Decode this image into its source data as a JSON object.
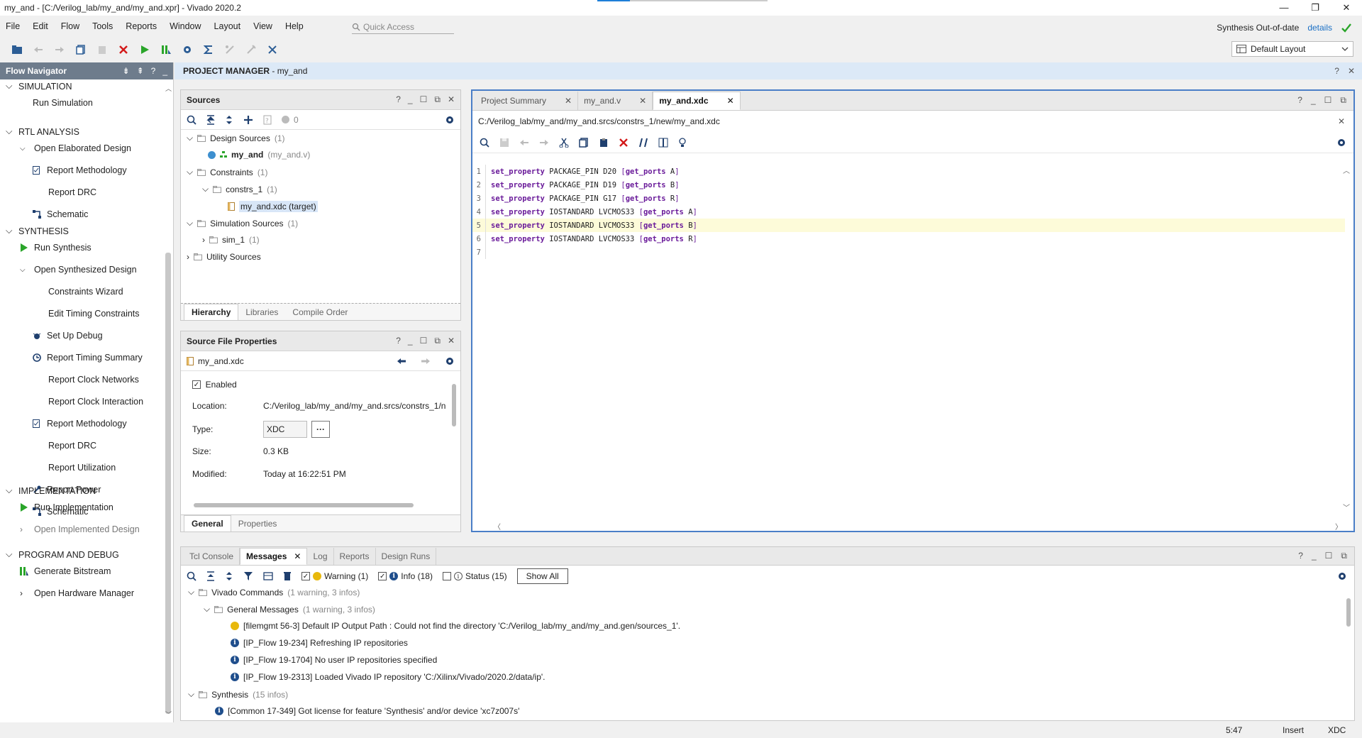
{
  "window": {
    "title": "my_and - [C:/Verilog_lab/my_and/my_and.xpr] - Vivado 2020.2",
    "controls": [
      "—",
      "❐",
      "✕"
    ]
  },
  "menu": [
    "File",
    "Edit",
    "Flow",
    "Tools",
    "Reports",
    "Window",
    "Layout",
    "View",
    "Help"
  ],
  "quick_access": {
    "placeholder": "Quick Access"
  },
  "synthesis_status": {
    "text": "Synthesis Out-of-date",
    "link": "details"
  },
  "layout_selector": {
    "value": "Default Layout"
  },
  "flow_navigator": {
    "title": "Flow Navigator",
    "sections": [
      {
        "label": "SIMULATION",
        "items": [
          {
            "label": "Run Simulation",
            "icon": ""
          }
        ]
      },
      {
        "label": "RTL ANALYSIS",
        "items": [
          {
            "label": "Open Elaborated Design",
            "icon": "chevron"
          },
          {
            "label": "Report Methodology",
            "icon": "report"
          },
          {
            "label": "Report DRC",
            "icon": ""
          },
          {
            "label": "Schematic",
            "icon": "schematic"
          }
        ]
      },
      {
        "label": "SYNTHESIS",
        "items": [
          {
            "label": "Run Synthesis",
            "icon": "run"
          },
          {
            "label": "Open Synthesized Design",
            "icon": "chevron"
          },
          {
            "label": "Constraints Wizard",
            "icon": ""
          },
          {
            "label": "Edit Timing Constraints",
            "icon": ""
          },
          {
            "label": "Set Up Debug",
            "icon": "debug"
          },
          {
            "label": "Report Timing Summary",
            "icon": "timing"
          },
          {
            "label": "Report Clock Networks",
            "icon": ""
          },
          {
            "label": "Report Clock Interaction",
            "icon": ""
          },
          {
            "label": "Report Methodology",
            "icon": "report"
          },
          {
            "label": "Report DRC",
            "icon": ""
          },
          {
            "label": "Report Utilization",
            "icon": ""
          },
          {
            "label": "Report Power",
            "icon": "power"
          },
          {
            "label": "Schematic",
            "icon": "schematic"
          }
        ]
      },
      {
        "label": "IMPLEMENTATION",
        "items": [
          {
            "label": "Run Implementation",
            "icon": "run"
          },
          {
            "label": "Open Implemented Design",
            "icon": "chevron-right"
          }
        ]
      },
      {
        "label": "PROGRAM AND DEBUG",
        "items": [
          {
            "label": "Generate Bitstream",
            "icon": "bitstream"
          },
          {
            "label": "Open Hardware Manager",
            "icon": "chevron-right"
          }
        ]
      }
    ]
  },
  "project_manager": {
    "title": "PROJECT MANAGER",
    "project": "- my_and"
  },
  "sources": {
    "title": "Sources",
    "count": "0",
    "tree": {
      "design_sources": "Design Sources",
      "design_sources_count": "(1)",
      "my_and": "my_and",
      "my_and_file": "(my_and.v)",
      "constraints": "Constraints",
      "constraints_count": "(1)",
      "constrs_1": "constrs_1",
      "constrs_1_count": "(1)",
      "xdc": "my_and.xdc (target)",
      "sim_sources": "Simulation Sources",
      "sim_sources_count": "(1)",
      "sim_1": "sim_1",
      "sim_1_count": "(1)",
      "utility": "Utility Sources"
    },
    "tabs": [
      "Hierarchy",
      "Libraries",
      "Compile Order"
    ]
  },
  "source_props": {
    "title": "Source File Properties",
    "file": "my_and.xdc",
    "enabled_label": "Enabled",
    "location_label": "Location:",
    "location": "C:/Verilog_lab/my_and/my_and.srcs/constrs_1/n",
    "type_label": "Type:",
    "type": "XDC",
    "size_label": "Size:",
    "size": "0.3 KB",
    "modified_label": "Modified:",
    "modified": "Today at 16:22:51 PM",
    "tabs": [
      "General",
      "Properties"
    ]
  },
  "editor": {
    "tabs": [
      "Project Summary",
      "my_and.v",
      "my_and.xdc"
    ],
    "path": "C:/Verilog_lab/my_and/my_and.srcs/constrs_1/new/my_and.xdc",
    "lines": [
      {
        "n": "1",
        "kw": "set_property",
        "prop": "PACKAGE_PIN",
        "val": "D20",
        "cmd": "get_ports",
        "port": "A"
      },
      {
        "n": "2",
        "kw": "set_property",
        "prop": "PACKAGE_PIN",
        "val": "D19",
        "cmd": "get_ports",
        "port": "B"
      },
      {
        "n": "3",
        "kw": "set_property",
        "prop": "PACKAGE_PIN",
        "val": "G17",
        "cmd": "get_ports",
        "port": "R"
      },
      {
        "n": "4",
        "kw": "set_property",
        "prop": "IOSTANDARD",
        "val": "LVCMOS33",
        "cmd": "get_ports",
        "port": "A"
      },
      {
        "n": "5",
        "kw": "set_property",
        "prop": "IOSTANDARD",
        "val": "LVCMOS33",
        "cmd": "get_ports",
        "port": "B"
      },
      {
        "n": "6",
        "kw": "set_property",
        "prop": "IOSTANDARD",
        "val": "LVCMOS33",
        "cmd": "get_ports",
        "port": "R"
      },
      {
        "n": "7",
        "kw": "",
        "prop": "",
        "val": "",
        "cmd": "",
        "port": ""
      }
    ],
    "highlight_line": 5
  },
  "messages": {
    "tabs": [
      "Tcl Console",
      "Messages",
      "Log",
      "Reports",
      "Design Runs"
    ],
    "filters": {
      "warning": "Warning (1)",
      "info": "Info (18)",
      "status": "Status (15)",
      "show_all": "Show All"
    },
    "tree": {
      "vivado_cmds": "Vivado Commands",
      "vivado_cmds_count": "(1 warning, 3 infos)",
      "general": "General Messages",
      "general_count": "(1 warning, 3 infos)",
      "m1": "[filemgmt 56-3] Default IP Output Path : Could not find the directory 'C:/Verilog_lab/my_and/my_and.gen/sources_1'.",
      "m2": "[IP_Flow 19-234] Refreshing IP repositories",
      "m3": "[IP_Flow 19-1704] No user IP repositories specified",
      "m4": "[IP_Flow 19-2313] Loaded Vivado IP repository 'C:/Xilinx/Vivado/2020.2/data/ip'.",
      "synthesis": "Synthesis",
      "synthesis_count": "(15 infos)",
      "m5": "[Common 17-349] Got license for feature 'Synthesis' and/or device 'xc7z007s'"
    }
  },
  "statusbar": {
    "position": "5:47",
    "mode": "Insert",
    "lang": "XDC"
  },
  "colors": {
    "accent": "#1e7fd8",
    "nav_header": "#6e7c8c",
    "pm_header": "#dce9f7",
    "run_green": "#2aa52a",
    "stop_red": "#d31a1a",
    "keyword": "#6a1b9a"
  }
}
